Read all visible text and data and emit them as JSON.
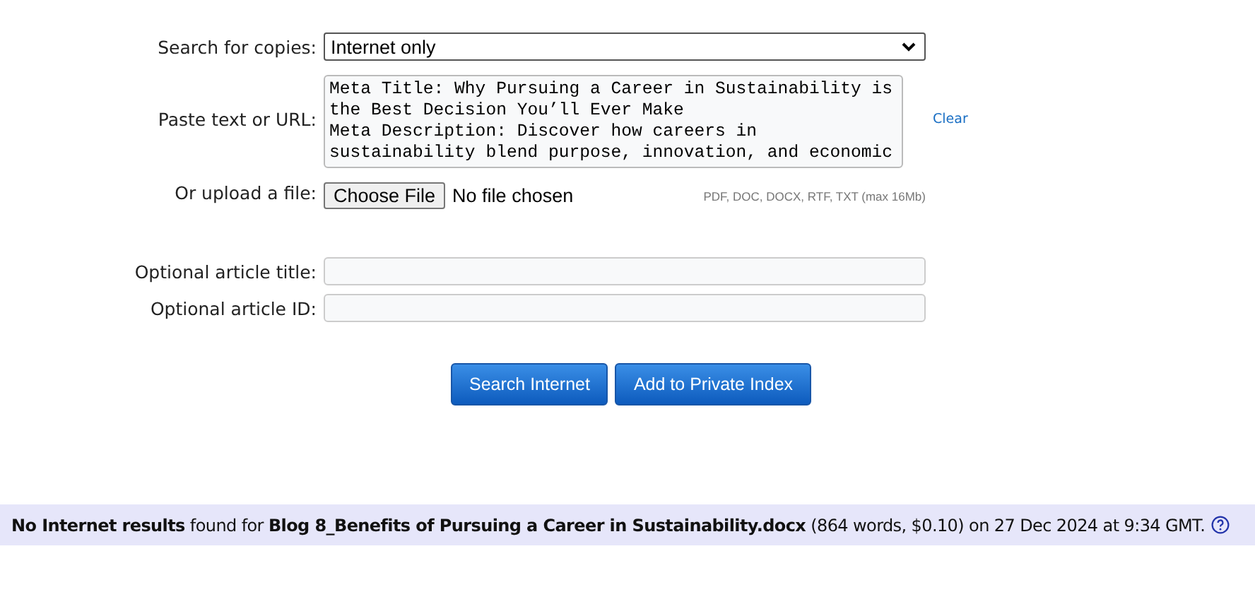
{
  "form": {
    "search_for_copies": {
      "label": "Search for copies:",
      "value": "Internet only"
    },
    "paste": {
      "label": "Paste text or URL:",
      "value": "Meta Title: Why Pursuing a Career in Sustainability is the Best Decision You’ll Ever Make\nMeta Description: Discover how careers in sustainability blend purpose, innovation, and economic",
      "clear_link": "Clear"
    },
    "upload": {
      "label": "Or upload a file:",
      "button": "Choose File",
      "status": "No file chosen",
      "hint": "PDF, DOC, DOCX, RTF, TXT (max 16Mb)"
    },
    "fields": [
      {
        "label": "Optional article title:"
      },
      {
        "label": "Optional article ID:"
      }
    ],
    "buttons": [
      "Search Internet",
      "Add to Private Index"
    ]
  },
  "status_bar": {
    "message": "**No Internet results** found for **Blog 8_Benefits of Pursuing a Career in Sustainability.docx** (864 words, $0.10) on 27 Dec 2024 at 9:34 GMT."
  }
}
